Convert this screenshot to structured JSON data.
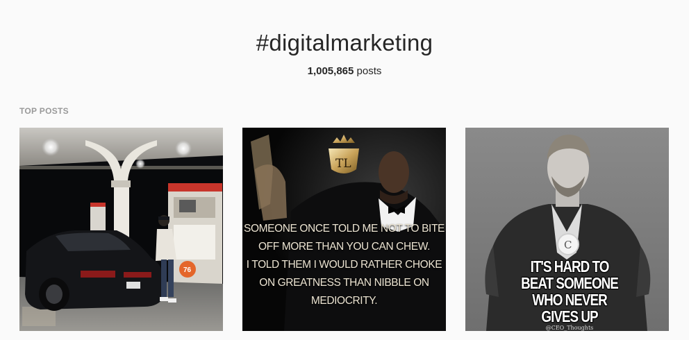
{
  "header": {
    "hashtag": "#digitalmarketing",
    "post_count": "1,005,865",
    "post_unit": " posts"
  },
  "top_posts": {
    "section_label": "TOP POSTS",
    "posts": [
      {
        "description": "photo",
        "station_sign": "76"
      },
      {
        "description": "quote",
        "logo_letters": "TL",
        "quote_lines": [
          "SOMEONE ONCE TOLD ME NOT TO BITE",
          "OFF MORE THAN  YOU CAN CHEW.",
          "I TOLD THEM I WOULD RATHER CHOKE",
          "ON GREATNESS THAN NIBBLE ON",
          "MEDIOCRITY."
        ]
      },
      {
        "description": "quote",
        "logo_letter": "C",
        "quote_lines": [
          "IT'S HARD TO",
          "BEAT SOMEONE",
          "WHO NEVER",
          "GIVES UP"
        ],
        "handle": "@CEO_Thoughts"
      }
    ]
  },
  "colors": {
    "background": "#fafafa",
    "text": "#262626",
    "muted": "#999999"
  }
}
